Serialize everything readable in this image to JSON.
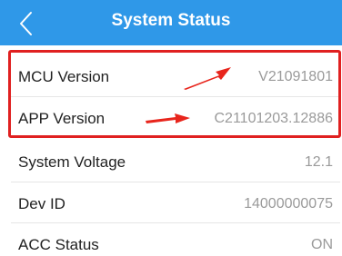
{
  "header": {
    "title": "System Status"
  },
  "rows": [
    {
      "label": "MCU Version",
      "value": "V21091801"
    },
    {
      "label": "APP Version",
      "value": "C21101203.12886"
    },
    {
      "label": "System Voltage",
      "value": "12.1"
    },
    {
      "label": "Dev ID",
      "value": "14000000075"
    },
    {
      "label": "ACC Status",
      "value": "ON"
    }
  ],
  "colors": {
    "header_bg": "#2f98e8",
    "highlight": "#e02020",
    "value_text": "#9a9a9a"
  },
  "icons": {
    "back": "chevron-left-icon",
    "annotation": "red-arrow-icon"
  }
}
